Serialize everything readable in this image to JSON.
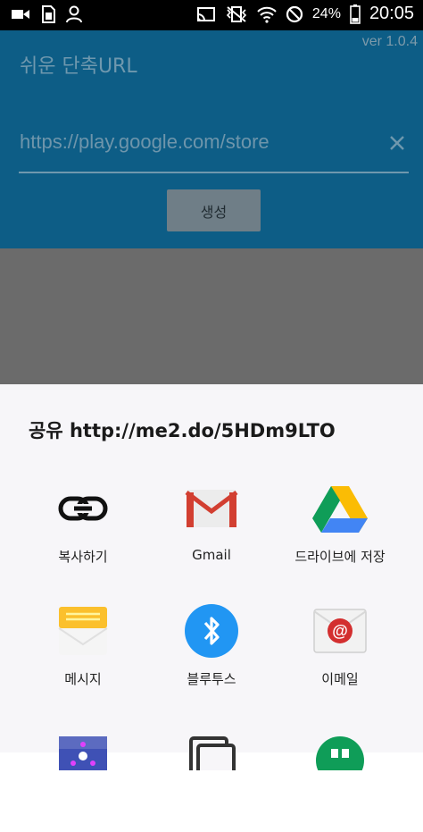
{
  "status_bar": {
    "battery_percent": "24%",
    "time": "20:05"
  },
  "app": {
    "version": "ver 1.0.4",
    "title": "쉬운 단축URL",
    "url_placeholder": "https://play.google.com/store",
    "generate_label": "생성"
  },
  "share": {
    "title": "공유 http://me2.do/5HDm9LTO",
    "items": [
      {
        "label": "복사하기",
        "icon": "link-icon"
      },
      {
        "label": "Gmail",
        "icon": "gmail-icon"
      },
      {
        "label": "드라이브에 저장",
        "icon": "google-drive-icon"
      },
      {
        "label": "메시지",
        "icon": "messages-icon"
      },
      {
        "label": "블루투스",
        "icon": "bluetooth-icon"
      },
      {
        "label": "이메일",
        "icon": "email-icon"
      }
    ],
    "partial_items": [
      "app-icon",
      "copy-icon",
      "hangouts-icon"
    ]
  },
  "colors": {
    "app_bar_dimmed": "#0d5d86",
    "sheet_background": "#f7f6f9",
    "scrim": "#6b6b6b"
  }
}
